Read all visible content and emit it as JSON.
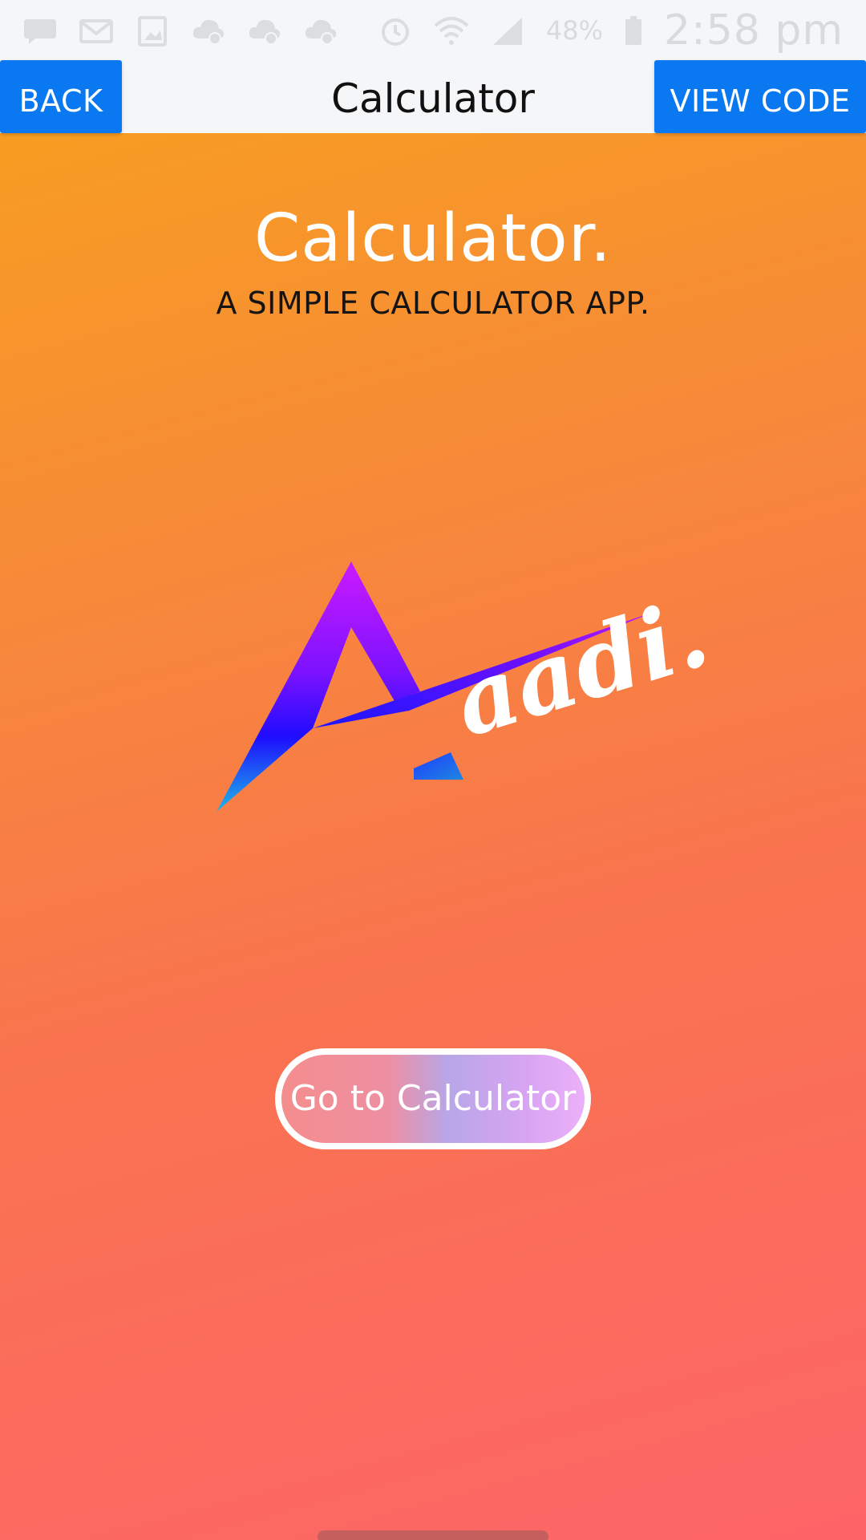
{
  "status_bar": {
    "icons": [
      "chat-icon",
      "mail-icon",
      "image-icon",
      "cloud-sync-icon",
      "cloud-sync-icon",
      "cloud-sync-icon",
      "alarm-icon",
      "wifi-icon",
      "signal-icon",
      "battery-icon"
    ],
    "battery": "48%",
    "time": "2:58 pm"
  },
  "app_bar": {
    "title": "Calculator",
    "back_label": "BACK",
    "view_code_label": "VIEW CODE"
  },
  "hero": {
    "title": "Calculator.",
    "subtitle": "A SIMPLE CALCULATOR APP."
  },
  "logo": {
    "wordmark": "aadi."
  },
  "cta": {
    "label": "Go to Calculator"
  },
  "colors": {
    "button_blue": "#0a78f0",
    "bg_top": "#f7a21b",
    "bg_bottom": "#fd6468",
    "bar_bg": "#f5f6f8"
  }
}
